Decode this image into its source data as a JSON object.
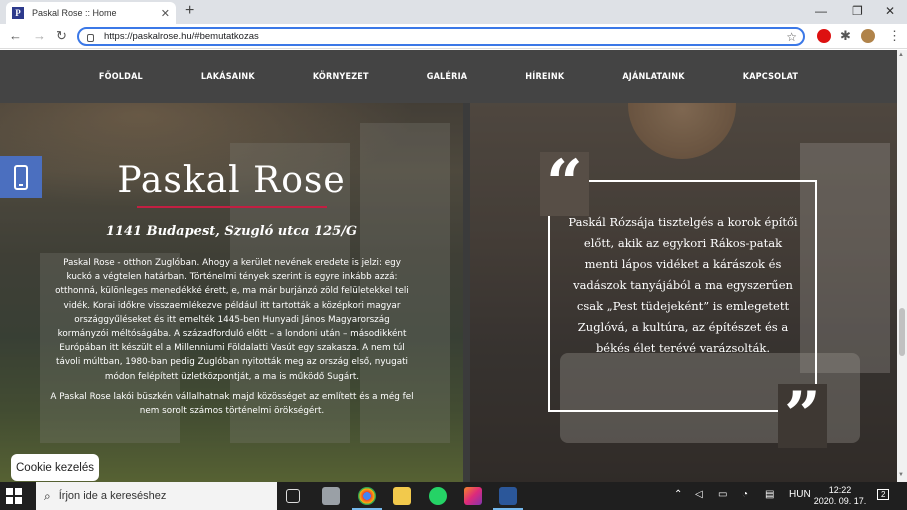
{
  "browser": {
    "tab_title": "Paskal Rose :: Home",
    "favicon_letter": "P",
    "new_tab": "+",
    "url": "https://paskalrose.hu/#bemutatkozas"
  },
  "site": {
    "nav": [
      "FŐOLDAL",
      "LAKÁSAINK",
      "KÖRNYEZET",
      "GALÉRIA",
      "HÍREINK",
      "AJÁNLATAINK",
      "KAPCSOLAT"
    ],
    "brand": "Paskal Rose",
    "address": "1141 Budapest, Szugló utca 125/G",
    "story_p1": "Paskal Rose - otthon Zuglóban. Ahogy a kerület nevének eredete is jelzi: egy kuckó a végtelen határban. Történelmi tények szerint is egyre inkább azzá: otthonná, különleges menedékké érett, e, ma már burjánzó zöld felületekkel teli vidék. Korai időkre visszaemlékezve például itt tartották a középkori magyar országgyűléseket és itt emelték 1445-ben Hunyadi János Magyarország kormányzói méltóságába. A századforduló előtt – a londoni után – másodikként Európában itt készült el a Millenniumi Földalatti Vasút egy szakasza. A nem túl távoli múltban, 1980-ban pedig Zuglóban nyitották meg az ország első, nyugati módon felépített üzletközpontját, a ma is működő Sugárt.",
    "story_p2": "A Paskal Rose lakói büszkén vállalhatnak majd közösséget az említett és a még fel nem sorolt számos történelmi örökségért.",
    "quote": "Paskál Rózsája tisztelgés a korok építői előtt, akik az egykori Rákos-patak menti lápos vidéket a kárászok és vadászok tanyájából a ma egyszerűen csak „Pest tüdejeként” is emlegetett Zuglóvá, a kultúra, az építészet és a békés élet terévé varázsolták.",
    "quote_open": "“",
    "quote_close": "”",
    "cookie_button": "Cookie kezelés"
  },
  "taskbar": {
    "search_placeholder": "Írjon ide a kereséshez",
    "language": "HUN",
    "time": "12:22",
    "date": "2020. 09. 17.",
    "notifications": "2"
  },
  "colors": {
    "accent": "#c21f42",
    "phone_tab": "#4b6fbf",
    "nav_bg": "#444444",
    "omnibox_border": "#3b78e7"
  },
  "icons": [
    "phone-icon",
    "back-icon",
    "forward-icon",
    "reload-icon",
    "lock-icon",
    "star-icon",
    "extension-icon",
    "menu-icon",
    "search-icon",
    "windows-start-icon"
  ]
}
